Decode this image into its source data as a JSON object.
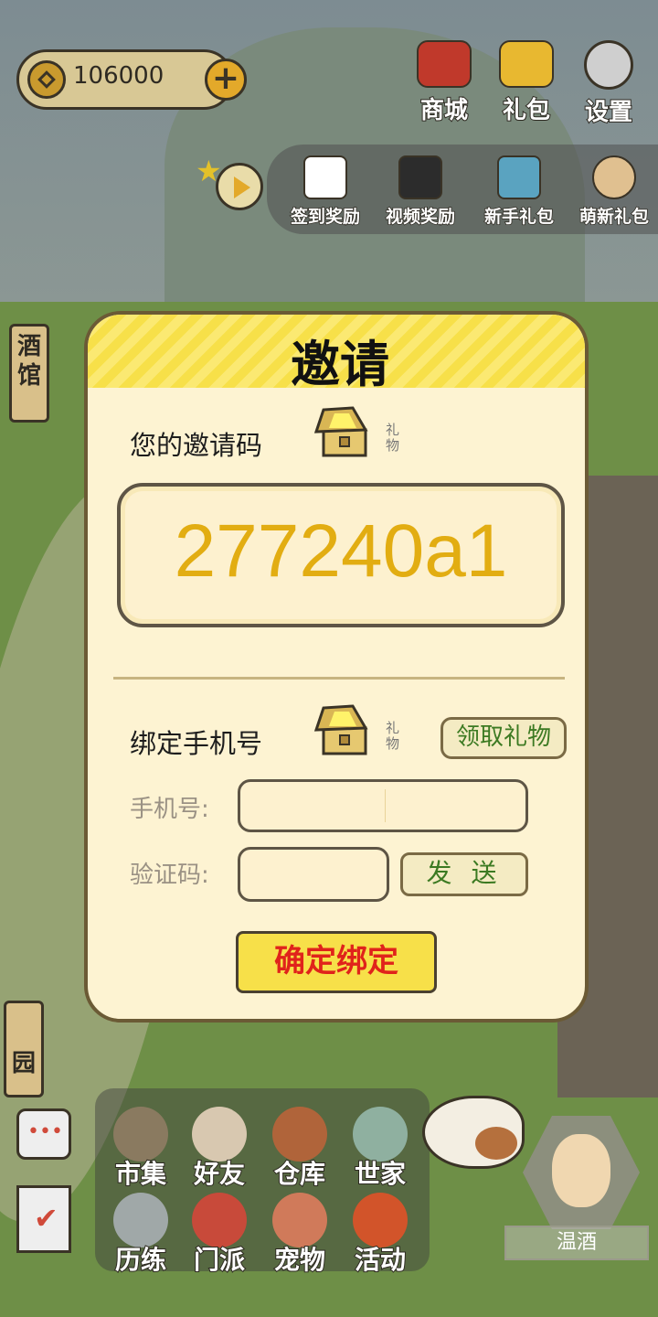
{
  "currency": {
    "amount": "106000"
  },
  "top_buttons": [
    {
      "label": "商城",
      "icon": "bag-icon"
    },
    {
      "label": "礼包",
      "icon": "gold-ingot-icon"
    },
    {
      "label": "设置",
      "icon": "gear-icon"
    }
  ],
  "activities": [
    {
      "label": "签到奖励",
      "icon": "calendar-icon"
    },
    {
      "label": "视频奖励",
      "icon": "clapperboard-icon"
    },
    {
      "label": "新手礼包",
      "icon": "chest-icon"
    },
    {
      "label": "萌新礼包",
      "icon": "character-icon"
    }
  ],
  "side_signs": {
    "tavern": "酒馆",
    "garden": "园"
  },
  "modal": {
    "title": "邀请",
    "invite_label": "您的邀请码",
    "gift_tag": "礼物",
    "invite_code": "277240a1",
    "bind_label": "绑定手机号",
    "claim_button": "领取礼物",
    "phone_label": "手机号:",
    "phone_value": "",
    "code_label": "验证码:",
    "code_value": "",
    "send_button": "发 送",
    "confirm_button": "确定绑定"
  },
  "bottom_menu": [
    {
      "label": "市集",
      "icon": "market-icon"
    },
    {
      "label": "好友",
      "icon": "handshake-icon"
    },
    {
      "label": "仓库",
      "icon": "storage-chest-icon"
    },
    {
      "label": "世家",
      "icon": "clan-icon"
    },
    {
      "label": "历练",
      "icon": "crossed-swords-icon"
    },
    {
      "label": "门派",
      "icon": "sect-icon"
    },
    {
      "label": "宠物",
      "icon": "paw-icon"
    },
    {
      "label": "活动",
      "icon": "lantern-icon"
    }
  ],
  "character": {
    "name": "温酒"
  },
  "colors": {
    "accent_yellow": "#f7e049",
    "code_gold": "#e2ad12",
    "confirm_red": "#e0231b",
    "green_text": "#3c7a22"
  }
}
